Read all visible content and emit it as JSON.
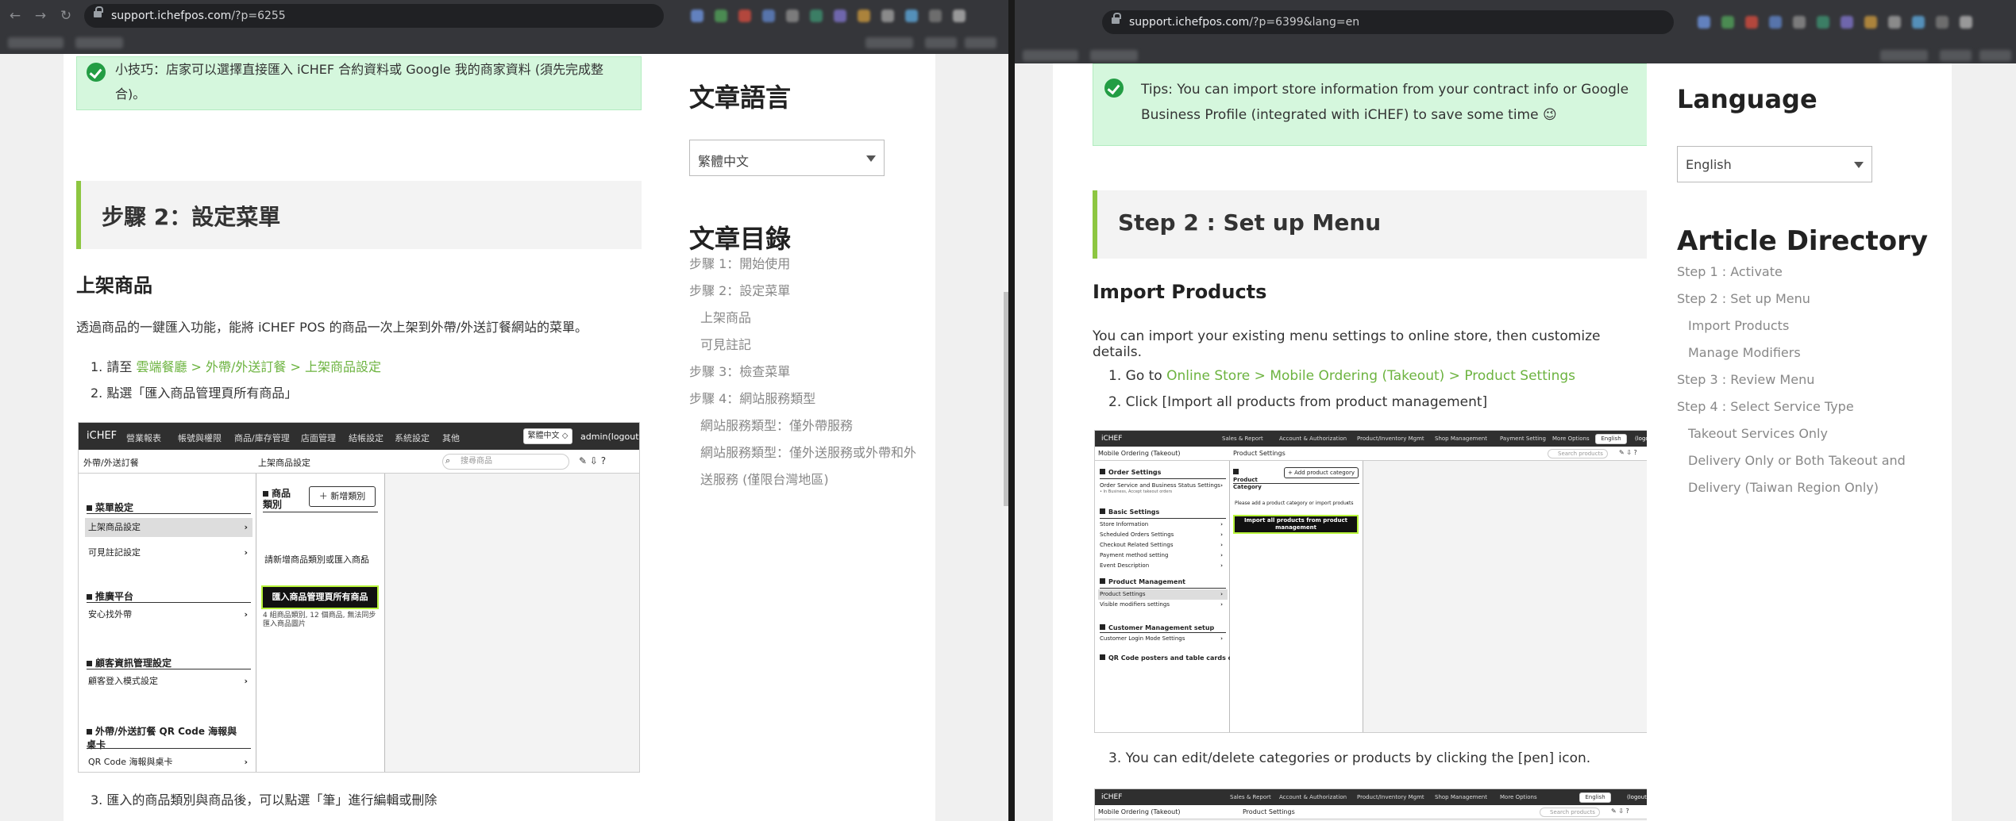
{
  "left": {
    "url": {
      "domain": "support.ichefpos.com",
      "path": "/?p=6255"
    },
    "tip": "小技巧：店家可以選擇直接匯入 iCHEF 合約資料或 Google 我的商家資料 (須先完成整合)。",
    "step_heading": "步驟 2：設定菜單",
    "subheading": "上架商品",
    "intro": "透過商品的一鍵匯入功能，能將 iCHEF POS 的商品一次上架到外帶/外送訂餐網站的菜單。",
    "steps": [
      {
        "num": "1.",
        "pre": "請至 ",
        "link": "雲端餐廳 > 外帶/外送訂餐 > 上架商品設定"
      },
      {
        "num": "2.",
        "text": "點選「匯入商品管理頁所有商品」"
      },
      {
        "num": "3.",
        "text": "匯入的商品類別與商品後，可以點選「筆」進行編輯或刪除"
      }
    ],
    "screenshot": {
      "brand": "iCHEF",
      "nav": [
        "營業報表",
        "帳號與權限",
        "商品/庫存管理",
        "店面管理",
        "結帳設定",
        "系統設定",
        "其他"
      ],
      "lang": "繁體中文 ◇",
      "admin": "admin(logout)",
      "section_left": "外帶/外送訂餐",
      "section_main": "上架商品設定",
      "search_placeholder": "搜尋商品",
      "icons": "✎  ⇩  ?",
      "sec_menu": "菜單設定",
      "item_products": "上架商品設定",
      "item_modifiers": "可見註記設定",
      "sec_promo": "推廣平台",
      "item_promo": "安心找外帶",
      "sec_customer": "顧客資訊管理設定",
      "item_login": "顧客登入模式設定",
      "sec_qr": "外帶/外送訂餐 QR Code 海報與桌卡",
      "item_qr": "QR Code 海報與桌卡",
      "cat_label": "商品類別",
      "add_cat": "＋ 新增類別",
      "please_add": "請新增商品類別或匯入商品",
      "import_btn": "匯入商品管理頁所有商品",
      "import_note": "4 組商品類別, 12 個商品, 無法同步匯入商品圖片"
    },
    "side_lang_title": "文章語言",
    "side_lang_value": "繁體中文",
    "side_toc_title": "文章目錄",
    "toc": [
      {
        "text": "步驟 1：開始使用",
        "sub": false
      },
      {
        "text": "步驟 2：設定菜單",
        "sub": false
      },
      {
        "text": "上架商品",
        "sub": true
      },
      {
        "text": "可見註記",
        "sub": true
      },
      {
        "text": "步驟 3：檢查菜單",
        "sub": false
      },
      {
        "text": "步驟 4：網站服務類型",
        "sub": false
      },
      {
        "text": "網站服務類型：僅外帶服務",
        "sub": true
      },
      {
        "text": "網站服務類型：僅外送服務或外帶和外送服務 (僅限台灣地區)",
        "sub": true
      }
    ]
  },
  "right": {
    "url": {
      "domain": "support.ichefpos.com",
      "path": "/?p=6399&lang=en"
    },
    "tip": "Tips: You can import store information from your contract info or Google Business Profile (integrated with iCHEF) to save some time 😉",
    "step_heading": "Step 2 : Set up Menu",
    "subheading": "Import Products",
    "intro": "You can import your existing menu settings to online store, then customize details.",
    "steps": [
      {
        "num": "1.",
        "pre": "Go to ",
        "link": "Online Store > Mobile Ordering (Takeout) > Product Settings"
      },
      {
        "num": "2.",
        "text": "Click [Import all products from product management]"
      },
      {
        "num": "3.",
        "text": "You can edit/delete categories or products by clicking the [pen] icon."
      }
    ],
    "screenshot": {
      "brand": "iCHEF",
      "nav": [
        "Sales & Report",
        "Account & Authorization",
        "Product/Inventory Mgmt",
        "Shop Management",
        "Payment Setting",
        "More Options"
      ],
      "lang": "English",
      "admin": "(logout)",
      "section_left": "Mobile Ordering (Takeout)",
      "section_main": "Product Settings",
      "search_placeholder": "Search products",
      "sec_order": "Order Settings",
      "item_order_service": "Order Service and Business Status Settings",
      "item_order_note": "• In Business, Accept takeout orders",
      "sec_basic": "Basic Settings",
      "item_store_info": "Store Information",
      "item_scheduled": "Scheduled Orders Settings",
      "item_checkout": "Checkout Related Settings",
      "item_payment": "Payment method setting",
      "item_event": "Event Description",
      "sec_product": "Product Management",
      "item_products": "Product Settings",
      "item_modifiers": "Visible modifiers settings",
      "sec_customer": "Customer Management setup",
      "item_login": "Customer Login Mode Settings",
      "sec_qr": "QR Code posters and table cards of",
      "cat_label": "Product Category",
      "add_cat": "+ Add product category",
      "please_add": "Please add a product category or import products",
      "import_btn": "Import all products from product management"
    },
    "screenshot2": {
      "brand": "iCHEF",
      "nav": [
        "Sales & Report",
        "Account & Authorization",
        "Product/Inventory Mgmt",
        "Shop Management",
        "More Options"
      ],
      "lang": "English",
      "admin": "(logout)",
      "section_left": "Mobile Ordering (Takeout)",
      "section_main": "Product Settings",
      "search_placeholder": "Search products"
    },
    "side_lang_title": "Language",
    "side_lang_value": "English",
    "side_toc_title": "Article Directory",
    "toc": [
      {
        "text": "Step 1 : Activate",
        "sub": false
      },
      {
        "text": "Step 2 : Set up Menu",
        "sub": false
      },
      {
        "text": "Import Products",
        "sub": true
      },
      {
        "text": "Manage Modifiers",
        "sub": true
      },
      {
        "text": "Step 3 : Review Menu",
        "sub": false
      },
      {
        "text": "Step 4 : Select Service Type",
        "sub": false
      },
      {
        "text": "Takeout Services Only",
        "sub": true
      },
      {
        "text": "Delivery Only or Both Takeout and Delivery (Taiwan Region Only)",
        "sub": true
      }
    ]
  },
  "colors": {
    "accent_green": "#8dc641",
    "link_green": "#6cb33f",
    "tip_bg": "#d5f7dd",
    "tip_icon": "#239d44"
  }
}
